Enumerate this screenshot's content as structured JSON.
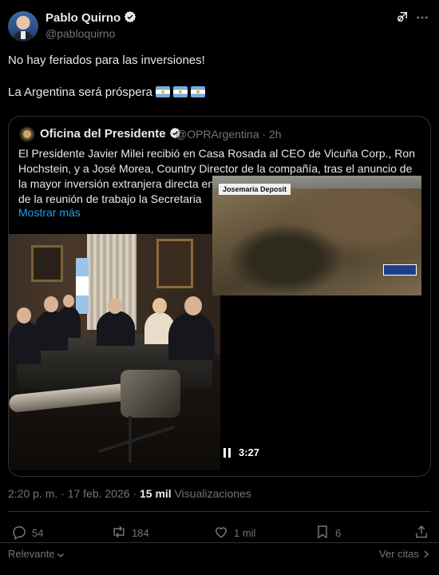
{
  "author": {
    "name": "Pablo Quirno",
    "handle": "@pabloquirno"
  },
  "tweet": {
    "line1": "No hay feriados para las inversiones!",
    "line2": "La Argentina será próspera"
  },
  "quoted": {
    "name": "Oficina del Presidente",
    "handle": "@OPRArgentina · 2h",
    "text": "El Presidente Javier Milei recibió en Casa Rosada al CEO de Vicuña Corp., Ron Hochstein, y a José Morea, Country Director de la compañía, tras el anuncio de la mayor inversión extranjera directa en la historia del país. También participaron de la reunión de trabajo la Secretaria",
    "show_more": "Mostrar más",
    "video_label": "Josemaria Deposit",
    "video_duration": "3:27"
  },
  "meta": {
    "time": "2:20 p. m. · 17 feb. 2026 · ",
    "views_count": "15 mil",
    "views_label": " Visualizaciones"
  },
  "actions": {
    "replies": "54",
    "reposts": "184",
    "likes": "1 mil",
    "bookmarks": "6"
  },
  "footer": {
    "sort_label": "Relevante",
    "quotes_label": "Ver citas"
  },
  "colors": {
    "background": "#000000",
    "text": "#e7e9ea",
    "muted": "#71767b",
    "link": "#1d9bf0",
    "border": "#2f3336"
  }
}
